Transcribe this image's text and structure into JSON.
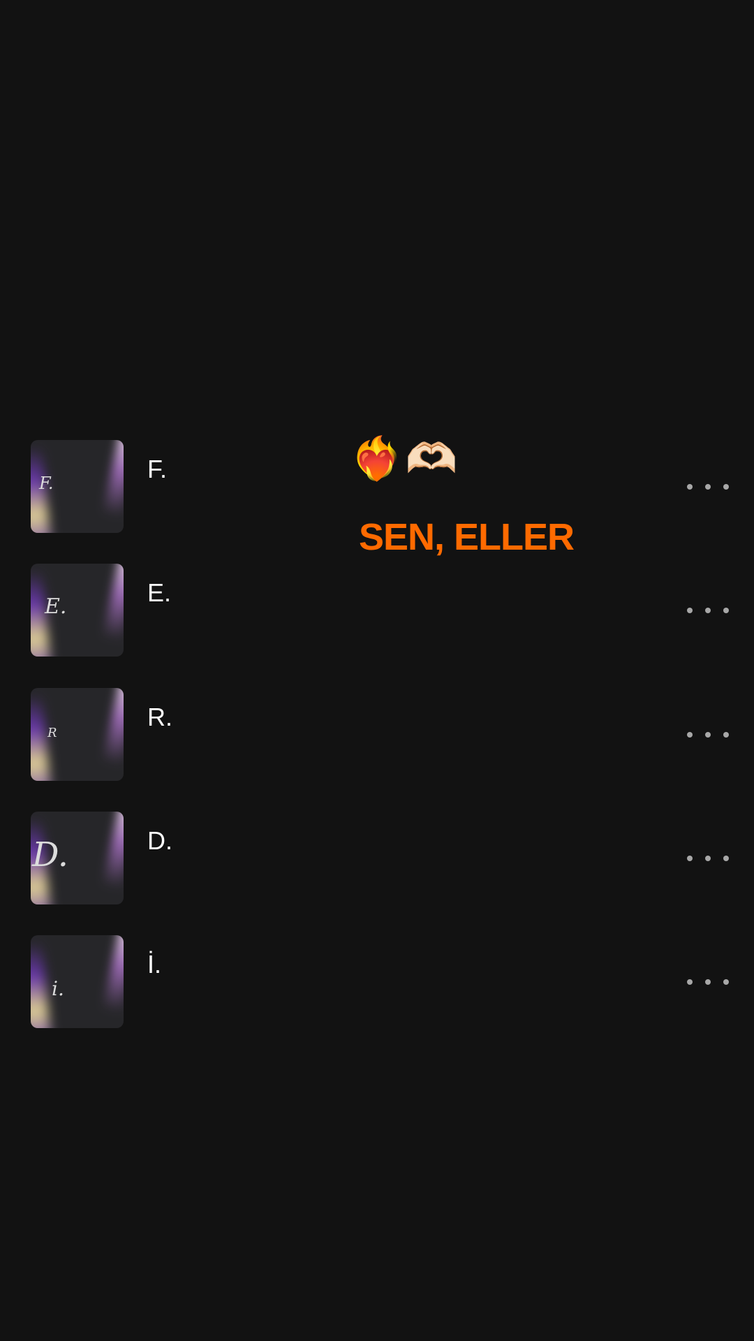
{
  "tracks": [
    {
      "title": "F.",
      "cover_letter": "F."
    },
    {
      "title": "E.",
      "cover_letter": "E."
    },
    {
      "title": "R.",
      "cover_letter": "R"
    },
    {
      "title": "D.",
      "cover_letter": "D."
    },
    {
      "title": "İ.",
      "cover_letter": "i."
    }
  ],
  "overlay": {
    "emoji": "❤️‍🔥🫶🏻",
    "caption": "SEN, ELLER"
  },
  "colors": {
    "background": "#121212",
    "caption": "#ff6a00",
    "more_dots": "#a7a7a7",
    "title": "#ffffff"
  },
  "icons": {
    "more": "more-horizontal-icon"
  }
}
